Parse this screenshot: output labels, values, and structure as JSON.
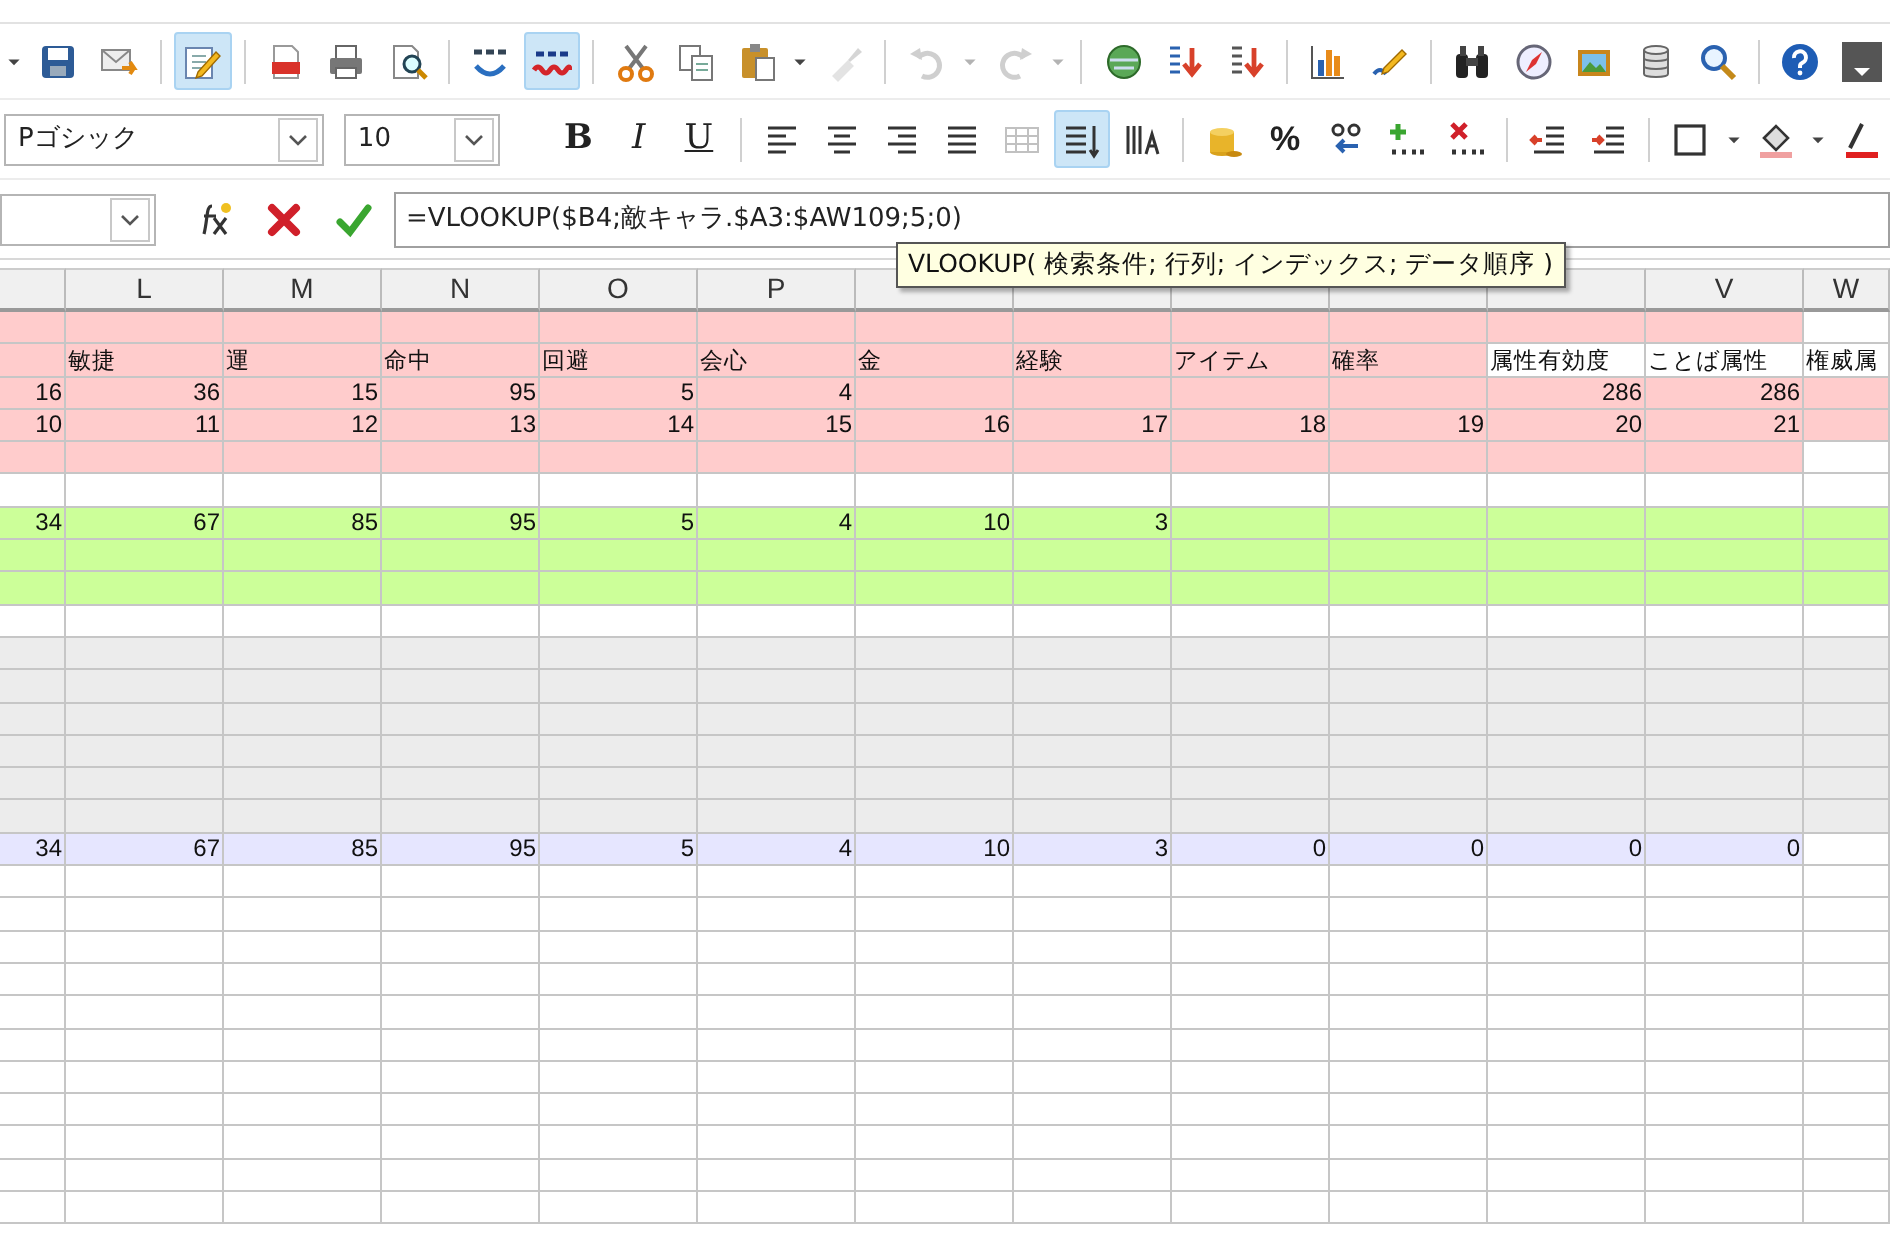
{
  "toolbar_standard": [
    {
      "kind": "caret",
      "disabled": false
    },
    {
      "kind": "save",
      "selected": false,
      "disabled": false
    },
    {
      "kind": "mail",
      "selected": false,
      "disabled": false
    },
    {
      "kind": "separator"
    },
    {
      "kind": "edit",
      "selected": true,
      "disabled": false
    },
    {
      "kind": "separator"
    },
    {
      "kind": "pdf",
      "selected": false,
      "disabled": false
    },
    {
      "kind": "print",
      "selected": false,
      "disabled": false
    },
    {
      "kind": "preview",
      "selected": false,
      "disabled": false
    },
    {
      "kind": "separator"
    },
    {
      "kind": "spell",
      "disabled": false
    },
    {
      "kind": "autospell",
      "selected": true,
      "disabled": false
    },
    {
      "kind": "separator"
    },
    {
      "kind": "cut",
      "selected": false,
      "disabled": false
    },
    {
      "kind": "copy",
      "selected": false,
      "disabled": false
    },
    {
      "kind": "paste",
      "selected": false,
      "disabled": false
    },
    {
      "kind": "caret",
      "disabled": false
    },
    {
      "kind": "clone",
      "selected": false,
      "disabled": true
    },
    {
      "kind": "separator"
    },
    {
      "kind": "undo",
      "selected": false,
      "disabled": true
    },
    {
      "kind": "caret",
      "disabled": true
    },
    {
      "kind": "redo",
      "selected": false,
      "disabled": true
    },
    {
      "kind": "caret",
      "disabled": true
    },
    {
      "kind": "separator"
    },
    {
      "kind": "globe",
      "selected": false,
      "disabled": false
    },
    {
      "kind": "sortasc",
      "selected": false,
      "disabled": false
    },
    {
      "kind": "sortdesc",
      "selected": false,
      "disabled": false
    },
    {
      "kind": "separator"
    },
    {
      "kind": "chart",
      "selected": false,
      "disabled": false
    },
    {
      "kind": "draw",
      "selected": false,
      "disabled": false
    },
    {
      "kind": "separator"
    },
    {
      "kind": "find",
      "selected": false,
      "disabled": false
    },
    {
      "kind": "compass",
      "selected": false,
      "disabled": false
    },
    {
      "kind": "gallery",
      "selected": false,
      "disabled": false
    },
    {
      "kind": "database",
      "selected": false,
      "disabled": false
    },
    {
      "kind": "zoom",
      "selected": false,
      "disabled": false
    },
    {
      "kind": "separator"
    },
    {
      "kind": "help",
      "selected": false,
      "disabled": false
    },
    {
      "kind": "overflow",
      "disabled": false
    }
  ],
  "font_name": {
    "value": "Pゴシック"
  },
  "font_size": {
    "value": "10"
  },
  "toolbar_formatting": [
    {
      "kind": "bold",
      "label": "B",
      "selected": false,
      "disabled": false
    },
    {
      "kind": "italic",
      "label": "I",
      "selected": false,
      "disabled": false
    },
    {
      "kind": "underline",
      "label": "U",
      "selected": false,
      "disabled": false
    },
    {
      "kind": "separator"
    },
    {
      "kind": "alignleft",
      "selected": false,
      "disabled": false
    },
    {
      "kind": "aligncenter",
      "selected": false,
      "disabled": false
    },
    {
      "kind": "alignright",
      "selected": false,
      "disabled": false
    },
    {
      "kind": "justify",
      "selected": false,
      "disabled": false
    },
    {
      "kind": "merge",
      "selected": false,
      "disabled": true
    },
    {
      "kind": "wrap",
      "selected": true,
      "disabled": false
    },
    {
      "kind": "vertical",
      "selected": false,
      "disabled": false
    },
    {
      "kind": "separator"
    },
    {
      "kind": "currency",
      "selected": false,
      "disabled": false
    },
    {
      "kind": "percent",
      "label": "%",
      "selected": false,
      "disabled": false
    },
    {
      "kind": "numformat",
      "selected": false,
      "disabled": false
    },
    {
      "kind": "adddecimal",
      "selected": false,
      "disabled": false
    },
    {
      "kind": "deldecimal",
      "selected": false,
      "disabled": false
    },
    {
      "kind": "separator"
    },
    {
      "kind": "outdent",
      "selected": false,
      "disabled": false
    },
    {
      "kind": "indent",
      "selected": false,
      "disabled": false
    },
    {
      "kind": "separator"
    },
    {
      "kind": "border",
      "selected": false,
      "disabled": false
    },
    {
      "kind": "caret",
      "disabled": false
    },
    {
      "kind": "bgcolor",
      "selected": false,
      "disabled": false
    },
    {
      "kind": "caret",
      "disabled": false
    },
    {
      "kind": "fontcolor",
      "selected": false,
      "disabled": false
    }
  ],
  "formula_bar": {
    "formula": "=VLOOKUP($B4;敵キャラ.$A3:$AW109;5;0)"
  },
  "tooltip": {
    "text": "VLOOKUP( 検索条件; 行列; インデックス; データ順序 )"
  },
  "columns": [
    {},
    {
      "label": "L"
    },
    {
      "label": "M"
    },
    {
      "label": "N"
    },
    {
      "label": "O"
    },
    {
      "label": "P"
    },
    {},
    {},
    {},
    {},
    {},
    {
      "label": "V"
    },
    {
      "label": "W"
    }
  ],
  "rows": [
    {
      "cells": [
        {
          "color": "#ffcccc"
        },
        {
          "color": "#ffcccc"
        },
        {
          "color": "#ffcccc"
        },
        {
          "color": "#ffcccc"
        },
        {
          "color": "#ffcccc"
        },
        {
          "color": "#ffcccc"
        },
        {
          "color": "#ffcccc"
        },
        {
          "color": "#ffcccc"
        },
        {
          "color": "#ffcccc"
        },
        {
          "color": "#ffcccc"
        },
        {
          "color": "#ffcccc"
        },
        {
          "color": "#ffcccc"
        },
        {
          "color": "#ffffff"
        }
      ]
    },
    {
      "cells": [
        {
          "color": "#ffcccc"
        },
        {
          "color": "#ffcccc",
          "kind": "label",
          "text": "敏捷"
        },
        {
          "color": "#ffcccc",
          "kind": "label",
          "text": "運"
        },
        {
          "color": "#ffcccc",
          "kind": "label",
          "text": "命中"
        },
        {
          "color": "#ffcccc",
          "kind": "label",
          "text": "回避"
        },
        {
          "color": "#ffcccc",
          "kind": "label",
          "text": "会心"
        },
        {
          "color": "#ffcccc",
          "kind": "label",
          "text": "金"
        },
        {
          "color": "#ffcccc",
          "kind": "label",
          "text": "経験"
        },
        {
          "color": "#ffcccc",
          "kind": "label",
          "text": "アイテム"
        },
        {
          "color": "#ffcccc",
          "kind": "label",
          "text": "確率"
        },
        {
          "color": "#ffffff",
          "kind": "label",
          "text": "属性有効度"
        },
        {
          "color": "#ffffff",
          "kind": "label",
          "text": "ことば属性"
        },
        {
          "color": "#ffffff",
          "kind": "label",
          "text": "権威属"
        }
      ]
    },
    {
      "cells": [
        {
          "color": "#ffcccc",
          "kind": "number",
          "text": "16"
        },
        {
          "color": "#ffcccc",
          "kind": "number",
          "text": "36"
        },
        {
          "color": "#ffcccc",
          "kind": "number",
          "text": "15"
        },
        {
          "color": "#ffcccc",
          "kind": "number",
          "text": "95"
        },
        {
          "color": "#ffcccc",
          "kind": "number",
          "text": "5"
        },
        {
          "color": "#ffcccc",
          "kind": "number",
          "text": "4"
        },
        {
          "color": "#ffcccc"
        },
        {
          "color": "#ffcccc"
        },
        {
          "color": "#ffcccc"
        },
        {
          "color": "#ffcccc"
        },
        {
          "color": "#ffcccc",
          "kind": "number",
          "text": "286"
        },
        {
          "color": "#ffcccc",
          "kind": "number",
          "text": "286"
        },
        {
          "color": "#ffcccc"
        }
      ]
    },
    {
      "cells": [
        {
          "color": "#ffcccc",
          "kind": "number",
          "text": "10"
        },
        {
          "color": "#ffcccc",
          "kind": "number",
          "text": "11"
        },
        {
          "color": "#ffcccc",
          "kind": "number",
          "text": "12"
        },
        {
          "color": "#ffcccc",
          "kind": "number",
          "text": "13"
        },
        {
          "color": "#ffcccc",
          "kind": "number",
          "text": "14"
        },
        {
          "color": "#ffcccc",
          "kind": "number",
          "text": "15"
        },
        {
          "color": "#ffcccc",
          "kind": "number",
          "text": "16"
        },
        {
          "color": "#ffcccc",
          "kind": "number",
          "text": "17"
        },
        {
          "color": "#ffcccc",
          "kind": "number",
          "text": "18"
        },
        {
          "color": "#ffcccc",
          "kind": "number",
          "text": "19"
        },
        {
          "color": "#ffcccc",
          "kind": "number",
          "text": "20"
        },
        {
          "color": "#ffcccc",
          "kind": "number",
          "text": "21"
        },
        {
          "color": "#ffcccc"
        }
      ]
    },
    {
      "cells": [
        {
          "color": "#ffcccc"
        },
        {
          "color": "#ffcccc"
        },
        {
          "color": "#ffcccc"
        },
        {
          "color": "#ffcccc"
        },
        {
          "color": "#ffcccc"
        },
        {
          "color": "#ffcccc"
        },
        {
          "color": "#ffcccc"
        },
        {
          "color": "#ffcccc"
        },
        {
          "color": "#ffcccc"
        },
        {
          "color": "#ffcccc"
        },
        {
          "color": "#ffcccc"
        },
        {
          "color": "#ffcccc"
        },
        {
          "color": "#ffffff"
        }
      ]
    },
    {
      "cells": [
        {
          "color": "#ffffff"
        },
        {
          "color": "#ffffff"
        },
        {
          "color": "#ffffff"
        },
        {
          "color": "#ffffff"
        },
        {
          "color": "#ffffff"
        },
        {
          "color": "#ffffff"
        },
        {
          "color": "#ffffff"
        },
        {
          "color": "#ffffff"
        },
        {
          "color": "#ffffff"
        },
        {
          "color": "#ffffff"
        },
        {
          "color": "#ffffff"
        },
        {
          "color": "#ffffff"
        },
        {
          "color": "#ffffff"
        }
      ]
    },
    {
      "cells": [
        {
          "color": "#ccff99",
          "kind": "number",
          "text": "34"
        },
        {
          "color": "#ccff99",
          "kind": "number",
          "text": "67"
        },
        {
          "color": "#ccff99",
          "kind": "number",
          "text": "85"
        },
        {
          "color": "#ccff99",
          "kind": "number",
          "text": "95"
        },
        {
          "color": "#ccff99",
          "kind": "number",
          "text": "5"
        },
        {
          "color": "#ccff99",
          "kind": "number",
          "text": "4"
        },
        {
          "color": "#ccff99",
          "kind": "number",
          "text": "10"
        },
        {
          "color": "#ccff99",
          "kind": "number",
          "text": "3"
        },
        {
          "color": "#ccff99"
        },
        {
          "color": "#ccff99"
        },
        {
          "color": "#ccff99"
        },
        {
          "color": "#ccff99"
        },
        {
          "color": "#ccff99"
        }
      ]
    },
    {
      "cells": [
        {
          "color": "#ccff99"
        },
        {
          "color": "#ccff99"
        },
        {
          "color": "#ccff99"
        },
        {
          "color": "#ccff99"
        },
        {
          "color": "#ccff99"
        },
        {
          "color": "#ccff99"
        },
        {
          "color": "#ccff99"
        },
        {
          "color": "#ccff99"
        },
        {
          "color": "#ccff99"
        },
        {
          "color": "#ccff99"
        },
        {
          "color": "#ccff99"
        },
        {
          "color": "#ccff99"
        },
        {
          "color": "#ccff99"
        }
      ]
    },
    {
      "cells": [
        {
          "color": "#ccff99"
        },
        {
          "color": "#ccff99"
        },
        {
          "color": "#ccff99"
        },
        {
          "color": "#ccff99"
        },
        {
          "color": "#ccff99"
        },
        {
          "color": "#ccff99"
        },
        {
          "color": "#ccff99"
        },
        {
          "color": "#ccff99"
        },
        {
          "color": "#ccff99"
        },
        {
          "color": "#ccff99"
        },
        {
          "color": "#ccff99"
        },
        {
          "color": "#ccff99"
        },
        {
          "color": "#ccff99"
        }
      ]
    },
    {
      "cells": [
        {
          "color": "#ffffff"
        },
        {
          "color": "#ffffff"
        },
        {
          "color": "#ffffff"
        },
        {
          "color": "#ffffff"
        },
        {
          "color": "#ffffff"
        },
        {
          "color": "#ffffff"
        },
        {
          "color": "#ffffff"
        },
        {
          "color": "#ffffff"
        },
        {
          "color": "#ffffff"
        },
        {
          "color": "#ffffff"
        },
        {
          "color": "#ffffff"
        },
        {
          "color": "#ffffff"
        },
        {
          "color": "#ffffff"
        }
      ]
    },
    {
      "cells": [
        {
          "color": "#ececec"
        },
        {
          "color": "#ececec"
        },
        {
          "color": "#ececec"
        },
        {
          "color": "#ececec"
        },
        {
          "color": "#ececec"
        },
        {
          "color": "#ececec"
        },
        {
          "color": "#ececec"
        },
        {
          "color": "#ececec"
        },
        {
          "color": "#ececec"
        },
        {
          "color": "#ececec"
        },
        {
          "color": "#ececec"
        },
        {
          "color": "#ececec"
        },
        {
          "color": "#ececec"
        }
      ]
    },
    {
      "cells": [
        {
          "color": "#ececec"
        },
        {
          "color": "#ececec"
        },
        {
          "color": "#ececec"
        },
        {
          "color": "#ececec"
        },
        {
          "color": "#ececec"
        },
        {
          "color": "#ececec"
        },
        {
          "color": "#ececec"
        },
        {
          "color": "#ececec"
        },
        {
          "color": "#ececec"
        },
        {
          "color": "#ececec"
        },
        {
          "color": "#ececec"
        },
        {
          "color": "#ececec"
        },
        {
          "color": "#ececec"
        }
      ]
    },
    {
      "cells": [
        {
          "color": "#ececec"
        },
        {
          "color": "#ececec"
        },
        {
          "color": "#ececec"
        },
        {
          "color": "#ececec"
        },
        {
          "color": "#ececec"
        },
        {
          "color": "#ececec"
        },
        {
          "color": "#ececec"
        },
        {
          "color": "#ececec"
        },
        {
          "color": "#ececec"
        },
        {
          "color": "#ececec"
        },
        {
          "color": "#ececec"
        },
        {
          "color": "#ececec"
        },
        {
          "color": "#ececec"
        }
      ]
    },
    {
      "cells": [
        {
          "color": "#ececec"
        },
        {
          "color": "#ececec"
        },
        {
          "color": "#ececec"
        },
        {
          "color": "#ececec"
        },
        {
          "color": "#ececec"
        },
        {
          "color": "#ececec"
        },
        {
          "color": "#ececec"
        },
        {
          "color": "#ececec"
        },
        {
          "color": "#ececec"
        },
        {
          "color": "#ececec"
        },
        {
          "color": "#ececec"
        },
        {
          "color": "#ececec"
        },
        {
          "color": "#ececec"
        }
      ]
    },
    {
      "cells": [
        {
          "color": "#ececec"
        },
        {
          "color": "#ececec"
        },
        {
          "color": "#ececec"
        },
        {
          "color": "#ececec"
        },
        {
          "color": "#ececec"
        },
        {
          "color": "#ececec"
        },
        {
          "color": "#ececec"
        },
        {
          "color": "#ececec"
        },
        {
          "color": "#ececec"
        },
        {
          "color": "#ececec"
        },
        {
          "color": "#ececec"
        },
        {
          "color": "#ececec"
        },
        {
          "color": "#ececec"
        }
      ]
    },
    {
      "cells": [
        {
          "color": "#ececec"
        },
        {
          "color": "#ececec"
        },
        {
          "color": "#ececec"
        },
        {
          "color": "#ececec"
        },
        {
          "color": "#ececec"
        },
        {
          "color": "#ececec"
        },
        {
          "color": "#ececec"
        },
        {
          "color": "#ececec"
        },
        {
          "color": "#ececec"
        },
        {
          "color": "#ececec"
        },
        {
          "color": "#ececec"
        },
        {
          "color": "#ececec"
        },
        {
          "color": "#ececec"
        }
      ]
    },
    {
      "cells": [
        {
          "color": "#e6e6ff",
          "kind": "number",
          "text": "34"
        },
        {
          "color": "#e6e6ff",
          "kind": "number",
          "text": "67"
        },
        {
          "color": "#e6e6ff",
          "kind": "number",
          "text": "85"
        },
        {
          "color": "#e6e6ff",
          "kind": "number",
          "text": "95"
        },
        {
          "color": "#e6e6ff",
          "kind": "number",
          "text": "5"
        },
        {
          "color": "#e6e6ff",
          "kind": "number",
          "text": "4"
        },
        {
          "color": "#e6e6ff",
          "kind": "number",
          "text": "10"
        },
        {
          "color": "#e6e6ff",
          "kind": "number",
          "text": "3"
        },
        {
          "color": "#e6e6ff",
          "kind": "number",
          "text": "0"
        },
        {
          "color": "#e6e6ff",
          "kind": "number",
          "text": "0"
        },
        {
          "color": "#e6e6ff",
          "kind": "number",
          "text": "0"
        },
        {
          "color": "#e6e6ff",
          "kind": "number",
          "text": "0"
        },
        {
          "color": "#ffffff"
        }
      ]
    }
  ]
}
